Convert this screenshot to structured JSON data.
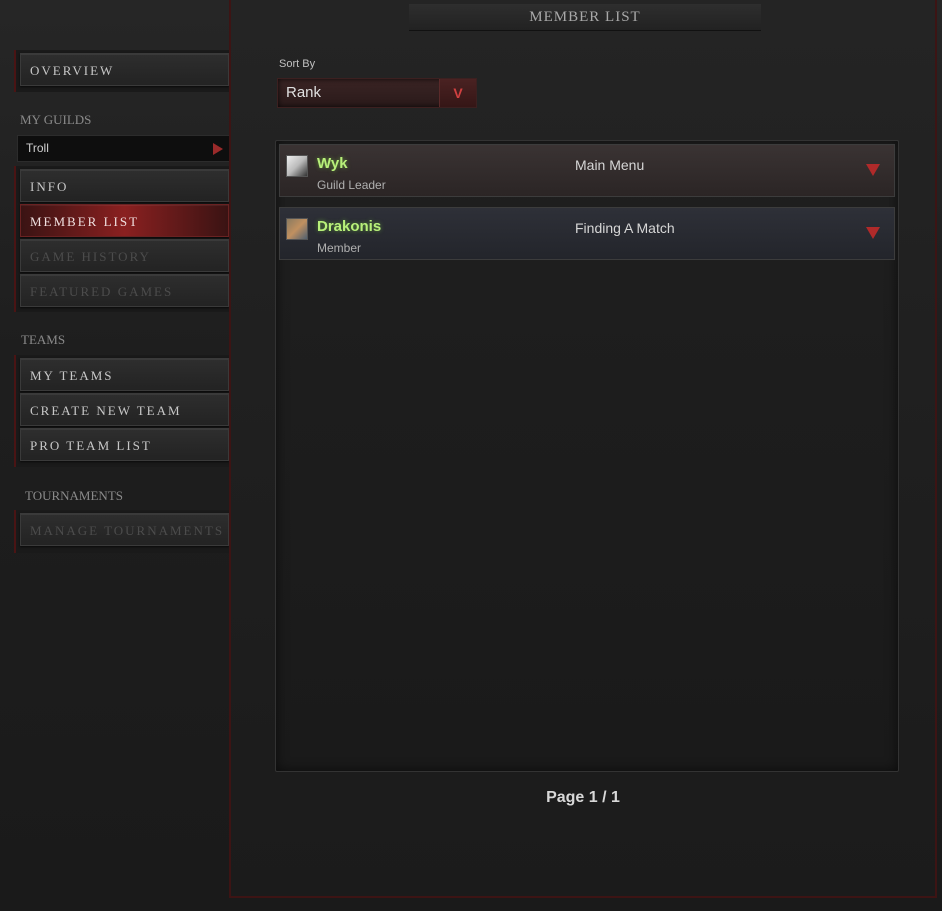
{
  "header": {
    "title": "MEMBER LIST"
  },
  "sidebar": {
    "overview_label": "OVERVIEW",
    "my_guilds_heading": "MY GUILDS",
    "guild_selected": "Troll",
    "guild_items": [
      {
        "label": "INFO",
        "state": "normal"
      },
      {
        "label": "MEMBER LIST",
        "state": "active"
      },
      {
        "label": "GAME HISTORY",
        "state": "disabled"
      },
      {
        "label": "FEATURED GAMES",
        "state": "disabled"
      }
    ],
    "teams_heading": "TEAMS",
    "team_items": [
      {
        "label": "MY TEAMS"
      },
      {
        "label": "CREATE NEW TEAM"
      },
      {
        "label": "PRO TEAM LIST"
      }
    ],
    "tournaments_heading": "TOURNAMENTS",
    "tournament_items": [
      {
        "label": "MANAGE TOURNAMENTS",
        "state": "disabled"
      }
    ]
  },
  "sort": {
    "label": "Sort By",
    "selected": "Rank"
  },
  "members": [
    {
      "name": "Wyk",
      "rank": "Guild Leader",
      "status": "Main Menu",
      "avatar_icon": "hero-portrait-icon"
    },
    {
      "name": "Drakonis",
      "rank": "Member",
      "status": "Finding A Match",
      "avatar_icon": "hero-portrait-icon"
    }
  ],
  "pagination": {
    "text": "Page 1 / 1"
  },
  "colors": {
    "accent_red": "#8a2020",
    "name_green": "#b8f07a",
    "arrow_red": "#b02a2a"
  }
}
